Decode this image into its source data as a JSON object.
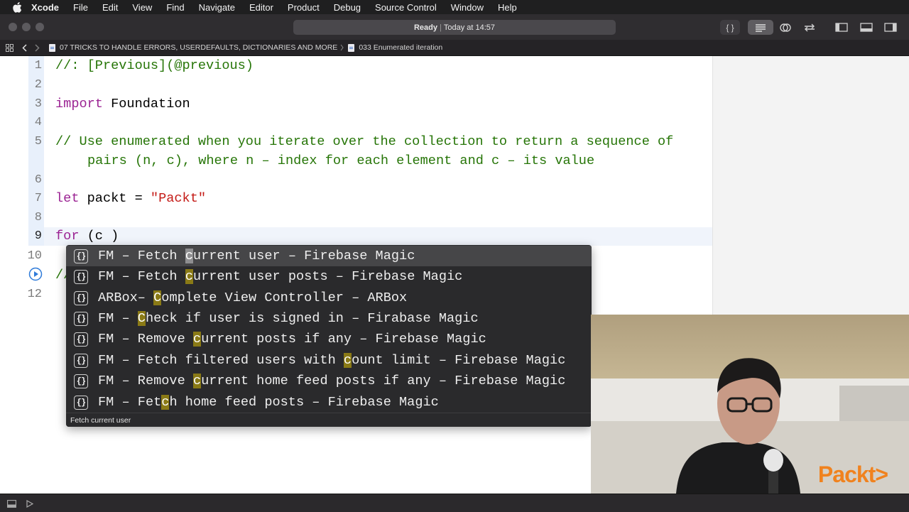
{
  "menubar": {
    "app": "Xcode",
    "items": [
      "File",
      "Edit",
      "View",
      "Find",
      "Navigate",
      "Editor",
      "Product",
      "Debug",
      "Source Control",
      "Window",
      "Help"
    ]
  },
  "toolbar": {
    "status_bold": "Ready",
    "status_sep": "|",
    "status_rest": "Today at 14:57",
    "braces_label": "{ }"
  },
  "jumpbar": {
    "crumbs": [
      "07 TRICKS TO HANDLE ERRORS, USERDEFAULTS, DICTIONARIES AND MORE",
      "033 Enumerated iteration"
    ]
  },
  "editor": {
    "line_numbers": [
      "1",
      "2",
      "3",
      "4",
      "5",
      "6",
      "7",
      "8",
      "9",
      "10",
      "12"
    ],
    "line1": "//: [Previous](@previous)",
    "line3_kw": "import",
    "line3_rest": " Foundation",
    "line5a": "// Use enumerated when you iterate over the collection to return a sequence of",
    "line5b": "pairs (n, c), where n – index for each element and c – its value",
    "line7_kw": "let",
    "line7_mid": " packt = ",
    "line7_str": "\"Packt\"",
    "line9_kw": "for",
    "line9_rest": " (c )",
    "line11_partial": "//"
  },
  "autocomplete": {
    "items": [
      {
        "pre": "FM – Fetch ",
        "hl": "c",
        "post": "urrent user – Firebase Magic"
      },
      {
        "pre": "FM – Fetch ",
        "hl": "c",
        "post": "urrent user posts – Firebase Magic"
      },
      {
        "pre": "ARBox– ",
        "hl": "C",
        "post": "omplete View Controller – ARBox"
      },
      {
        "pre": "FM – ",
        "hl": "C",
        "post": "heck if user is signed in – Firabase Magic"
      },
      {
        "pre": "FM – Remove ",
        "hl": "c",
        "post": "urrent posts if any – Firebase Magic"
      },
      {
        "pre": "FM – Fetch filtered users with ",
        "hl": "c",
        "post": "ount limit – Firebase Magic"
      },
      {
        "pre": "FM – Remove ",
        "hl": "c",
        "post": "urrent home feed posts if any – Firebase Magic"
      },
      {
        "pre": "FM – Fet",
        "hl": "c",
        "post": "h home feed posts – Firebase Magic"
      }
    ],
    "footer": "Fetch current user",
    "snippet_glyph": "{}"
  },
  "webcam": {
    "logo": "Packt>"
  },
  "colors": {
    "comment": "#267507",
    "keyword": "#9b2393",
    "string": "#c41a16",
    "logo": "#f0821e"
  }
}
